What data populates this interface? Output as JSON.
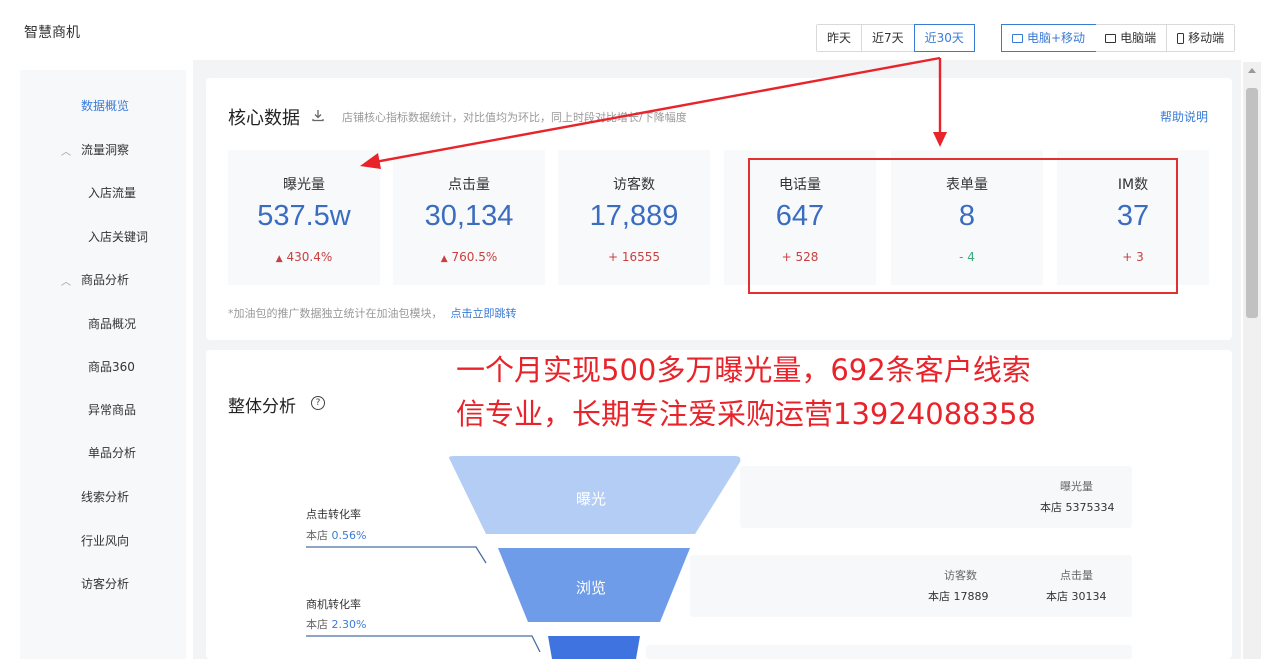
{
  "app": {
    "title": "智慧商机"
  },
  "date_tabs": [
    {
      "label": "昨天",
      "active": false
    },
    {
      "label": "近7天",
      "active": false
    },
    {
      "label": "近30天",
      "active": true
    }
  ],
  "device_tabs": [
    {
      "label": "电脑+移动",
      "icon": "devices-icon",
      "active": true
    },
    {
      "label": "电脑端",
      "icon": "desktop-icon",
      "active": false
    },
    {
      "label": "移动端",
      "icon": "phone-icon",
      "active": false
    }
  ],
  "sidebar": {
    "items": [
      {
        "label": "数据概览",
        "active": true
      },
      {
        "label": "流量洞察",
        "expandable": true
      },
      {
        "label": "入店流量"
      },
      {
        "label": "入店关键词"
      },
      {
        "label": "商品分析",
        "expandable": true
      },
      {
        "label": "商品概况"
      },
      {
        "label": "商品360"
      },
      {
        "label": "异常商品"
      },
      {
        "label": "单品分析"
      },
      {
        "label": "线索分析"
      },
      {
        "label": "行业风向"
      },
      {
        "label": "访客分析"
      }
    ]
  },
  "core": {
    "title": "核心数据",
    "subtitle": "店铺核心指标数据统计，对比值均为环比，同上时段对比增长/下降幅度",
    "help": "帮助说明",
    "metrics": [
      {
        "label": "曝光量",
        "value": "537.5w",
        "change": "430.4%",
        "direction": "up",
        "arrow": "▲"
      },
      {
        "label": "点击量",
        "value": "30,134",
        "change": "760.5%",
        "direction": "up",
        "arrow": "▲"
      },
      {
        "label": "访客数",
        "value": "17,889",
        "change": "+ 16555",
        "direction": "up"
      },
      {
        "label": "电话量",
        "value": "647",
        "change": "+ 528",
        "direction": "up"
      },
      {
        "label": "表单量",
        "value": "8",
        "change": "- 4",
        "direction": "down"
      },
      {
        "label": "IM数",
        "value": "37",
        "change": "+ 3",
        "direction": "up"
      }
    ],
    "note": "*加油包的推广数据独立统计在加油包模块，",
    "note_link": "点击立即跳转"
  },
  "overlay": {
    "line1": "一个月实现500多万曝光量，692条客户线索",
    "line2": "信专业，长期专注爱采购运营13924088358",
    "color": "#e8232a"
  },
  "overall": {
    "title": "整体分析",
    "help_icon": "?",
    "funnel": [
      {
        "label": "曝光",
        "color": "#b4cdf5"
      },
      {
        "label": "浏览",
        "color": "#6f9ce9"
      },
      {
        "label": "",
        "color": "#3f74e0"
      }
    ],
    "conversions": [
      {
        "label": "点击转化率",
        "prefix": "本店 ",
        "value": "0.56%"
      },
      {
        "label": "商机转化率",
        "prefix": "本店 ",
        "value": "2.30%"
      }
    ],
    "stats": [
      {
        "items": [
          {
            "label": "曝光量",
            "value": "本店 5375334"
          }
        ]
      },
      {
        "items": [
          {
            "label": "访客数",
            "value": "本店 17889"
          },
          {
            "label": "点击量",
            "value": "本店 30134"
          }
        ]
      }
    ]
  },
  "colors": {
    "accent": "#3a7bd5",
    "value_blue": "#3a6cc0",
    "up_red": "#c94040",
    "down_green": "#3aaa7a",
    "annotation_red": "#e03030"
  }
}
